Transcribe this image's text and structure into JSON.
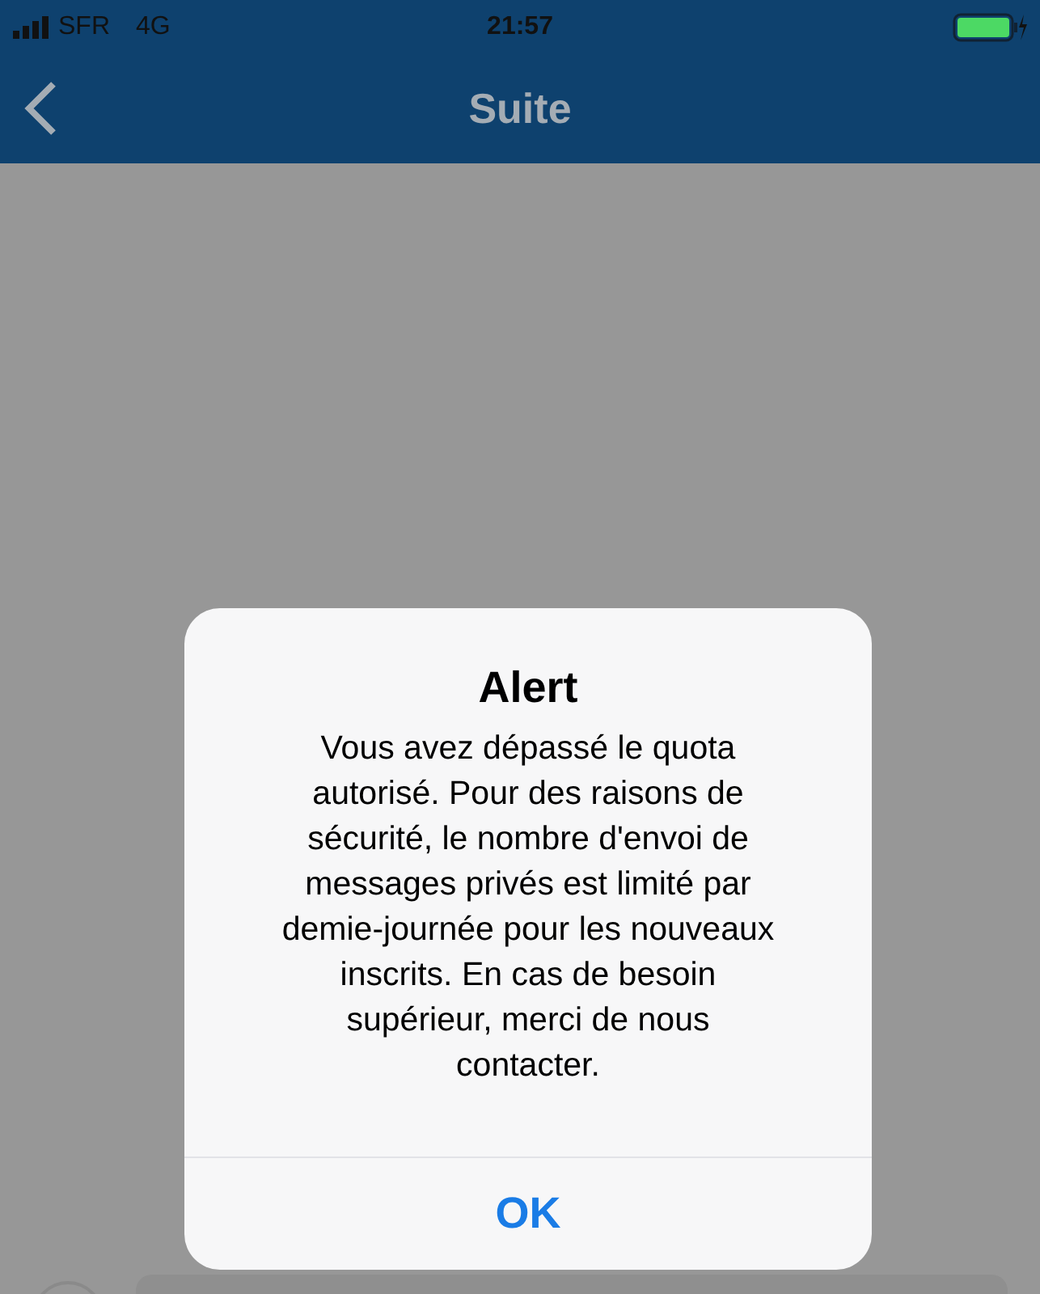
{
  "status_bar": {
    "carrier": "SFR",
    "network": "4G",
    "time": "21:57"
  },
  "nav_bar": {
    "title": "Suite"
  },
  "alert": {
    "title": "Alert",
    "message": "Vous avez dépassé le quota autorisé. Pour des raisons de sécurité, le nombre d'envoi de messages privés est limité par demie-journée pour les nouveaux inscrits. En cas de besoin supérieur, merci de nous contacter.",
    "buttons": [
      "OK"
    ]
  }
}
